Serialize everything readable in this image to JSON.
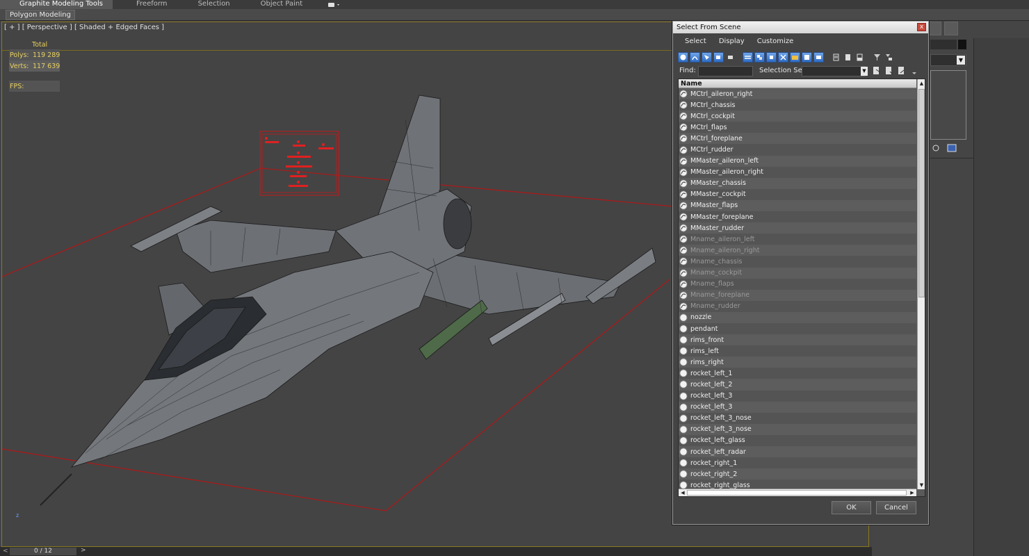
{
  "ribbon": {
    "tabs": [
      "Graphite Modeling Tools",
      "Freeform",
      "Selection",
      "Object Paint"
    ],
    "sub_button": "Polygon Modeling"
  },
  "viewport": {
    "label": "[ + ] [ Perspective ] [ Shaded + Edged Faces ]",
    "stats_header": "Total",
    "polys_label": "Polys:",
    "polys_value": "119 289",
    "verts_label": "Verts:",
    "verts_value": "117 639",
    "fps_label": "FPS:",
    "axis_label": "z"
  },
  "statusbar": {
    "left_arrow": "<",
    "counter": "0 / 12",
    "right_arrow": ">"
  },
  "dialog": {
    "title": "Select From Scene",
    "close_glyph": "x",
    "menu": [
      "Select",
      "Display",
      "Customize"
    ],
    "find_label": "Find:",
    "find_value": "",
    "selection_set_label": "Selection Set:",
    "column_name": "Name",
    "ok_label": "OK",
    "cancel_label": "Cancel",
    "items": [
      {
        "name": "MCtrl_aileron_right",
        "type": "shape"
      },
      {
        "name": "MCtrl_chassis",
        "type": "shape"
      },
      {
        "name": "MCtrl_cockpit",
        "type": "shape"
      },
      {
        "name": "MCtrl_flaps",
        "type": "shape"
      },
      {
        "name": "MCtrl_foreplane",
        "type": "shape"
      },
      {
        "name": "MCtrl_rudder",
        "type": "shape"
      },
      {
        "name": "MMaster_aileron_left",
        "type": "shape"
      },
      {
        "name": "MMaster_aileron_right",
        "type": "shape"
      },
      {
        "name": "MMaster_chassis",
        "type": "shape"
      },
      {
        "name": "MMaster_cockpit",
        "type": "shape"
      },
      {
        "name": "MMaster_flaps",
        "type": "shape"
      },
      {
        "name": "MMaster_foreplane",
        "type": "shape"
      },
      {
        "name": "MMaster_rudder",
        "type": "shape"
      },
      {
        "name": "Mname_aileron_left",
        "type": "shape",
        "dim": true
      },
      {
        "name": "Mname_aileron_right",
        "type": "shape",
        "dim": true
      },
      {
        "name": "Mname_chassis",
        "type": "shape",
        "dim": true
      },
      {
        "name": "Mname_cockpit",
        "type": "shape",
        "dim": true
      },
      {
        "name": "Mname_flaps",
        "type": "shape",
        "dim": true
      },
      {
        "name": "Mname_foreplane",
        "type": "shape",
        "dim": true
      },
      {
        "name": "Mname_rudder",
        "type": "shape",
        "dim": true
      },
      {
        "name": "nozzle",
        "type": "geometry"
      },
      {
        "name": "pendant",
        "type": "geometry"
      },
      {
        "name": "rims_front",
        "type": "geometry"
      },
      {
        "name": "rims_left",
        "type": "geometry"
      },
      {
        "name": "rims_right",
        "type": "geometry"
      },
      {
        "name": "rocket_left_1",
        "type": "geometry"
      },
      {
        "name": "rocket_left_2",
        "type": "geometry"
      },
      {
        "name": "rocket_left_3",
        "type": "geometry"
      },
      {
        "name": "rocket_left_3",
        "type": "geometry"
      },
      {
        "name": "rocket_left_3_nose",
        "type": "geometry"
      },
      {
        "name": "rocket_left_3_nose",
        "type": "geometry"
      },
      {
        "name": "rocket_left_glass",
        "type": "geometry"
      },
      {
        "name": "rocket_left_radar",
        "type": "geometry"
      },
      {
        "name": "rocket_right_1",
        "type": "geometry"
      },
      {
        "name": "rocket_right_2",
        "type": "geometry"
      },
      {
        "name": "rocket_right_glass",
        "type": "geometry"
      }
    ]
  },
  "colors": {
    "accent_blue": "#2f6bc4",
    "viewport_border": "#8a7a20",
    "stats_text": "#e8d060",
    "grid_red": "#b01818"
  }
}
